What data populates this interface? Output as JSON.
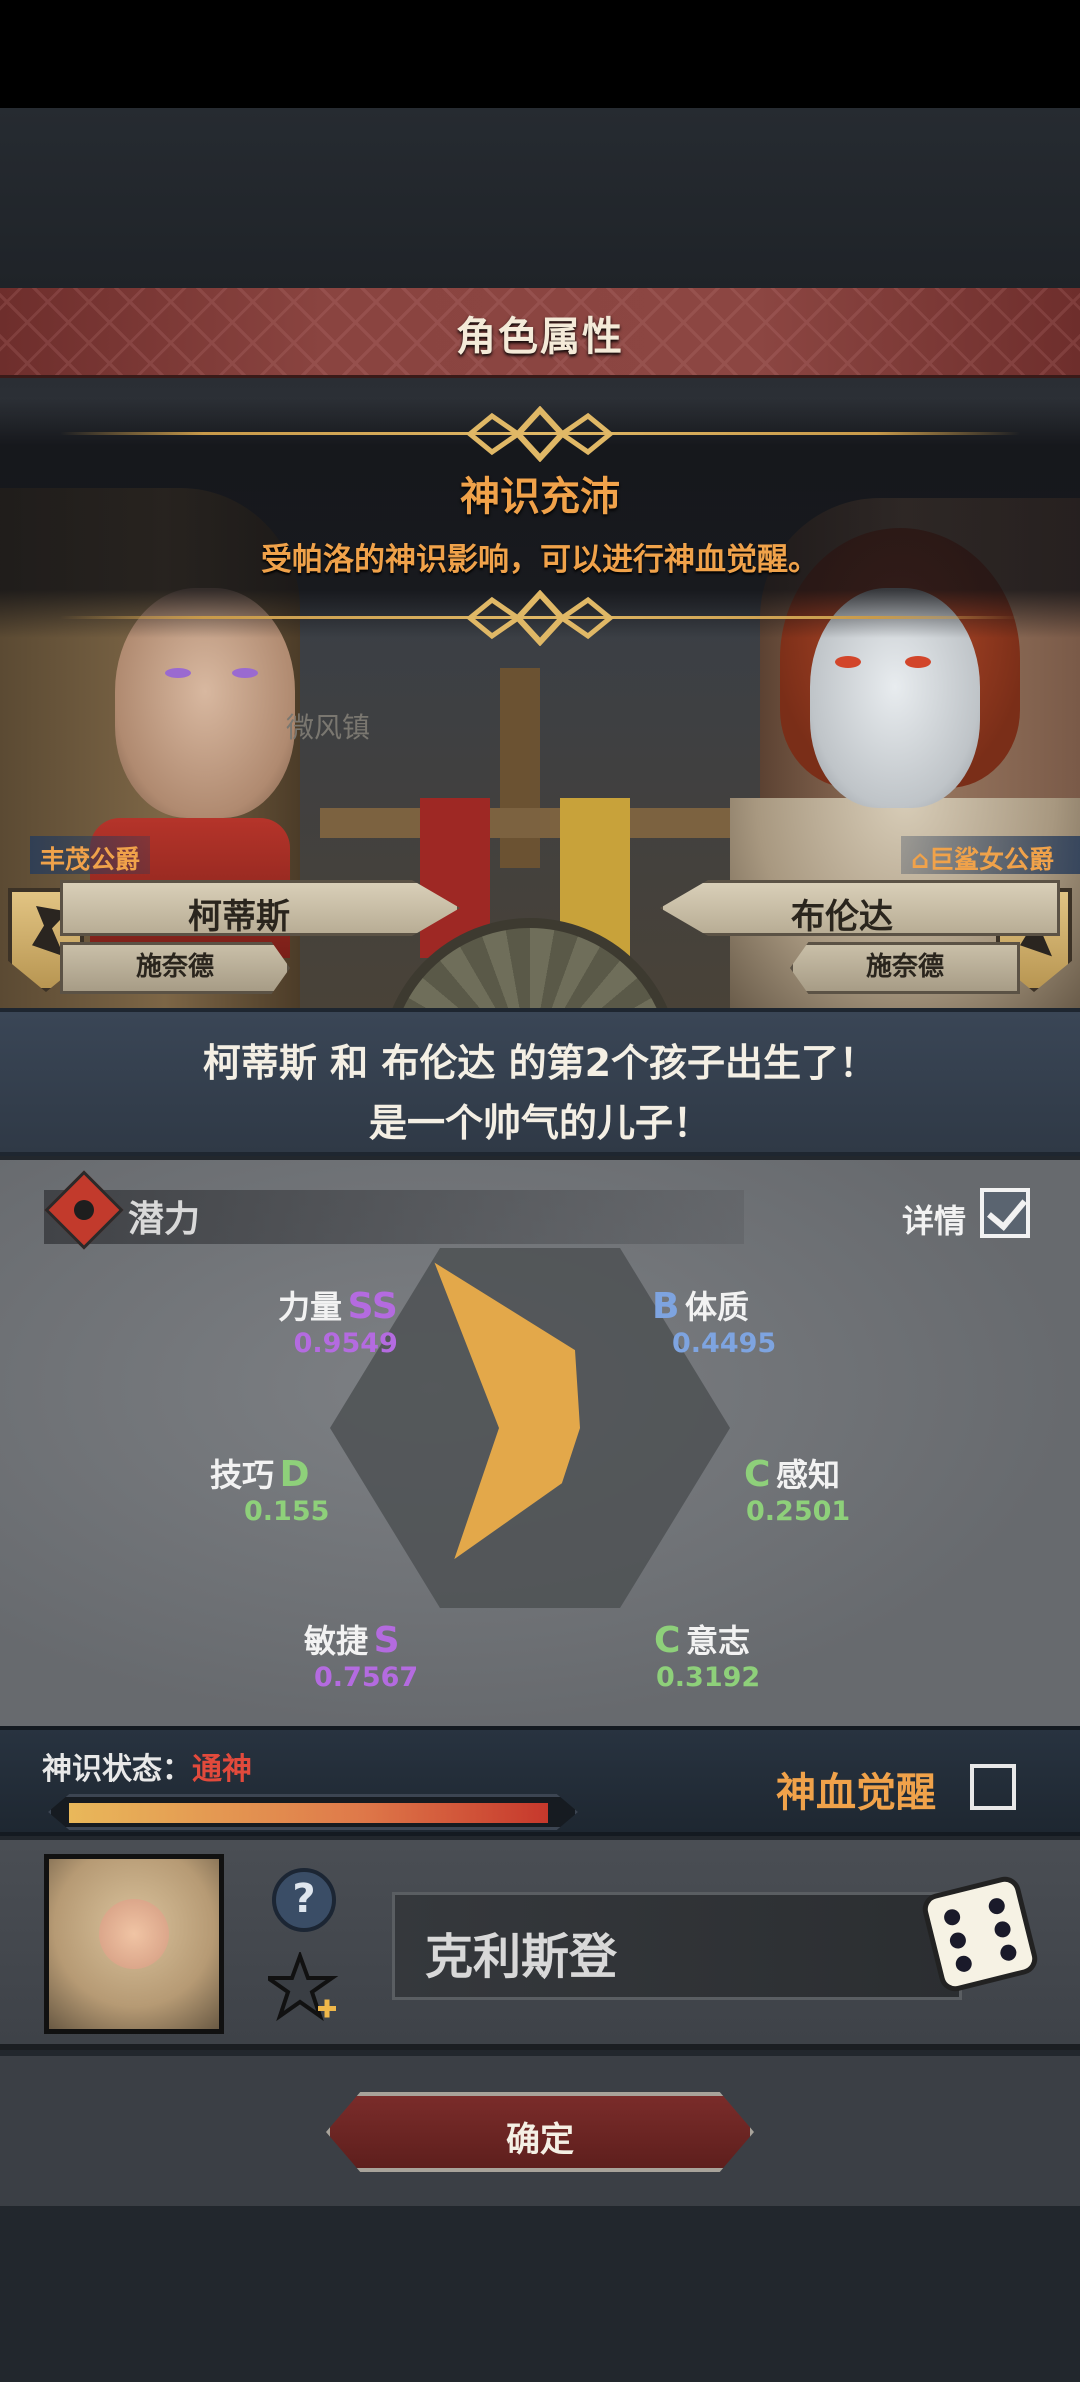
{
  "header": {
    "title": "角色属性"
  },
  "god_sense": {
    "title": "神识充沛",
    "description": "受帕洛的神识影响，可以进行神血觉醒。"
  },
  "scene": {
    "town": "微风镇"
  },
  "father": {
    "title": "丰茂公爵",
    "name": "柯蒂斯",
    "house": "施奈德"
  },
  "mother": {
    "title": "巨鲨女公爵",
    "name": "布伦达",
    "house": "施奈德"
  },
  "birth": {
    "line1": "柯蒂斯 和 布伦达 的第2个孩子出生了！",
    "line2": "是一个帅气的儿子！"
  },
  "potential": {
    "label": "潜力",
    "detail_label": "详情",
    "detail_checked": true,
    "stats": {
      "strength": {
        "name": "力量",
        "grade": "SS",
        "value": "0.9549"
      },
      "constitution": {
        "name": "体质",
        "grade": "B",
        "value": "0.4495"
      },
      "skill": {
        "name": "技巧",
        "grade": "D",
        "value": "0.155"
      },
      "perception": {
        "name": "感知",
        "grade": "C",
        "value": "0.2501"
      },
      "agility": {
        "name": "敏捷",
        "grade": "S",
        "value": "0.7567"
      },
      "will": {
        "name": "意志",
        "grade": "C",
        "value": "0.3192"
      }
    },
    "colors": {
      "purple": "#b46be0",
      "blue": "#7ea4e0",
      "green": "#8ed07a",
      "radar_fill": "#e3a84a"
    }
  },
  "god_state": {
    "label": "神识状态：",
    "value": "通神",
    "progress": 0.97,
    "awaken_label": "神血觉醒",
    "awaken_checked": false
  },
  "child": {
    "name": "克利斯登",
    "help_icon": "question-icon",
    "favorite_icon": "star-plus-icon",
    "random_icon": "dice-icon"
  },
  "footer": {
    "confirm_label": "确定"
  }
}
